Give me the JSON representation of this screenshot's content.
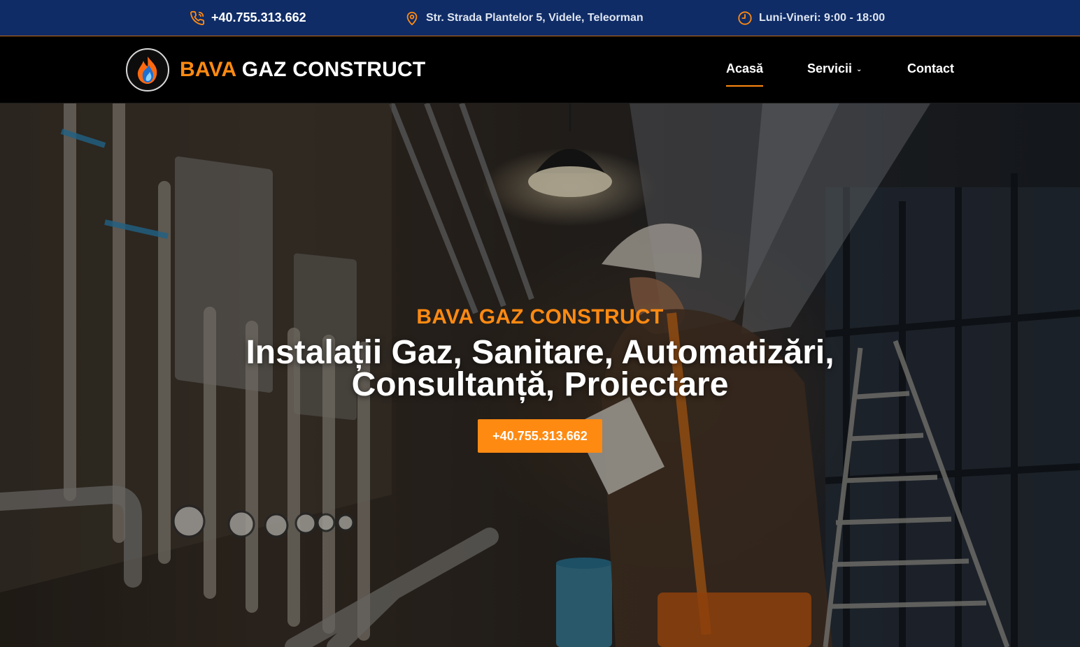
{
  "topbar": {
    "phone": "+40.755.313.662",
    "address": "Str. Strada Plantelor 5, Videle, Teleorman",
    "hours": "Luni-Vineri: 9:00 - 18:00",
    "icons": {
      "phone": "phone-icon",
      "address": "map-pin-icon",
      "hours": "clock-icon"
    }
  },
  "header": {
    "brand_accent": "BAVA",
    "brand_rest": " GAZ CONSTRUCT",
    "nav": {
      "home": "Acasă",
      "services": "Servicii",
      "contact": "Contact"
    },
    "active_nav": "Acasă"
  },
  "hero": {
    "eyebrow": "BAVA GAZ CONSTRUCT",
    "title_line1": "Instalații Gaz, Sanitare, Automatizări,",
    "title_line2": "Consultanță, Proiectare",
    "cta_label": "+40.755.313.662"
  },
  "colors": {
    "topbar_bg": "#0f2c66",
    "accent": "#ff8a12",
    "header_bg": "#000000"
  }
}
